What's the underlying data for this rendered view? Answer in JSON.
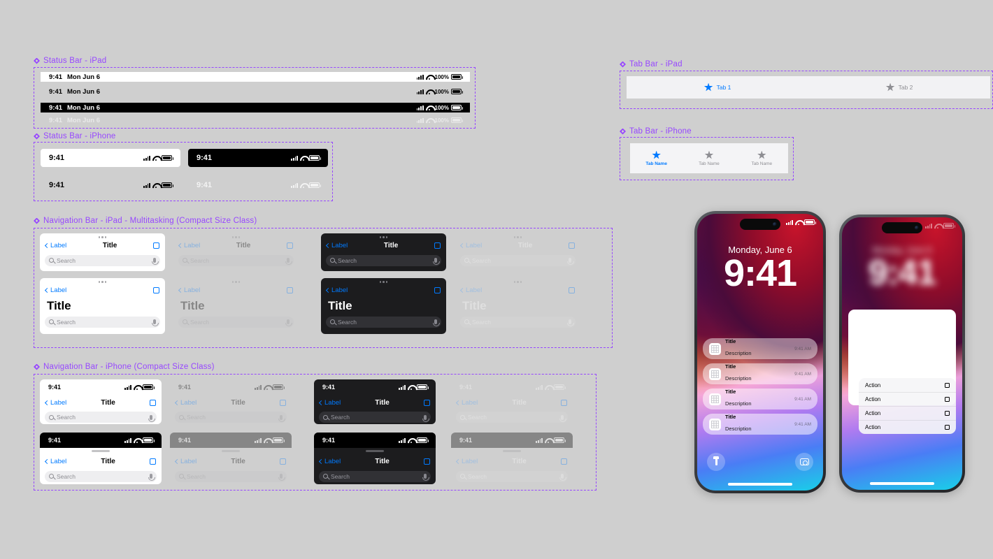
{
  "background": "#cfcfcf",
  "accent": "#9747ff",
  "ios_blue": "#007aff",
  "sections": {
    "status_bar_ipad": "Status Bar - iPad",
    "status_bar_iphone": "Status Bar - iPhone",
    "nav_ipad": "Navigation Bar - iPad - Multitasking (Compact Size Class)",
    "nav_iphone": "Navigation Bar - iPhone (Compact Size Class)",
    "tab_ipad": "Tab Bar - iPad",
    "tab_iphone": "Tab Bar - iPhone"
  },
  "status_ipad": {
    "time": "9:41",
    "date": "Mon Jun 6",
    "battery_pct": "100%",
    "icons": [
      "signal-bars-icon",
      "wifi-icon",
      "battery-icon"
    ],
    "variants": [
      "light",
      "light-transparent",
      "dark",
      "dark-transparent"
    ]
  },
  "status_iphone": {
    "time": "9:41",
    "icons": [
      "signal-bars-icon",
      "wifi-icon",
      "battery-icon"
    ],
    "variants": [
      "light",
      "dark",
      "light-transparent",
      "dark-transparent"
    ]
  },
  "navbar": {
    "back_label": "Label",
    "title": "Title",
    "large_title": "Title",
    "search_placeholder": "Search",
    "action_icon": "square-icon",
    "mic_icon": "microphone-icon",
    "search_icon": "magnifier-icon",
    "back_icon": "chevron-left-icon",
    "grabber_icon": "grabber-handle-icon",
    "dots_icon": "three-dots-icon",
    "status_time": "9:41"
  },
  "tab_bar_ipad": {
    "tabs": [
      {
        "label": "Tab 1",
        "selected": true,
        "icon": "star-icon"
      },
      {
        "label": "Tab 2",
        "selected": false,
        "icon": "star-icon"
      }
    ]
  },
  "tab_bar_iphone": {
    "tabs": [
      {
        "label": "Tab Name",
        "selected": true,
        "icon": "star-icon"
      },
      {
        "label": "Tab Name",
        "selected": false,
        "icon": "star-icon"
      },
      {
        "label": "Tab Name",
        "selected": false,
        "icon": "star-icon"
      }
    ]
  },
  "phone_lock": {
    "date": "Monday, June 6",
    "time": "9:41",
    "status_icons": [
      "signal-bars-icon",
      "wifi-icon",
      "battery-icon"
    ],
    "notifications": [
      {
        "title": "Title",
        "description": "Description",
        "time": "9:41 AM"
      },
      {
        "title": "Title",
        "description": "Description",
        "time": "9:41 AM"
      },
      {
        "title": "Title",
        "description": "Description",
        "time": "9:41 AM"
      },
      {
        "title": "Title",
        "description": "Description",
        "time": "9:41 AM"
      }
    ],
    "quick_actions": [
      {
        "name": "flashlight-button",
        "icon": "flashlight-icon"
      },
      {
        "name": "camera-button",
        "icon": "camera-icon"
      }
    ]
  },
  "phone_sheet": {
    "date": "Monday, June 6",
    "time": "9:41",
    "context_menu": [
      {
        "label": "Action",
        "icon": "square-icon"
      },
      {
        "label": "Action",
        "icon": "square-icon"
      },
      {
        "label": "Action",
        "icon": "square-icon"
      },
      {
        "label": "Action",
        "icon": "square-icon"
      }
    ]
  }
}
